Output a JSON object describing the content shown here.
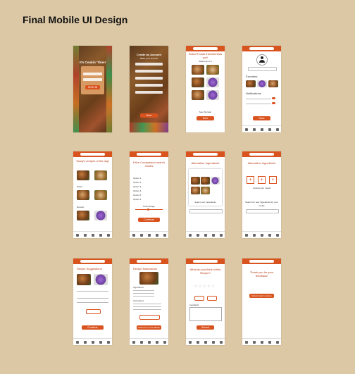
{
  "page_title": "Final Mobile UI Design",
  "screens": {
    "s1": {
      "title": "It's Cookin' Time!",
      "button": "SIGN IN"
    },
    "s2": {
      "title": "Create an Account",
      "subtitle": "Make your account",
      "button": "Next"
    },
    "s3": {
      "title": "Select Foods that interests you!",
      "subtitle": "Select up to 5",
      "button": "Next",
      "note": "See this later"
    },
    "s4": {
      "section_favorites": "Favorites",
      "section_notifications": "Notifications",
      "button": "Save"
    },
    "s5": {
      "title": "Today's recipes of the day!",
      "sec_a": "Pasta",
      "sec_b": "Dessert"
    },
    "s6": {
      "title": "Price Comparison search results",
      "items": [
        "Option 1",
        "Option 2",
        "Option 3",
        "Option 4",
        "Option 5",
        "Option 6"
      ],
      "button": "Continue",
      "price_label": "Price Range"
    },
    "s7": {
      "title": "Alternative Ingredients",
      "caption": "Select your ingredients"
    },
    "s8": {
      "title": "Alternative Ingredients",
      "caption": "Upload your meals",
      "search_note": "Search for new ingredients for your meals"
    },
    "s9": {
      "title": "Recipe Suggestions",
      "button": "Continue"
    },
    "s10": {
      "title": "Recipe Instructions",
      "sec_ing": "Ingredients",
      "sec_ins": "Instructions",
      "button": "Click here for feedback"
    },
    "s11": {
      "title": "What do you think of this Recipe?",
      "feedback_label": "Feedback",
      "button": "Submit"
    },
    "s12": {
      "title": "Thank you for your feedback!",
      "button": "Return back to Home"
    }
  },
  "colors": {
    "accent": "#d9531e",
    "background": "#dcc8a5"
  }
}
